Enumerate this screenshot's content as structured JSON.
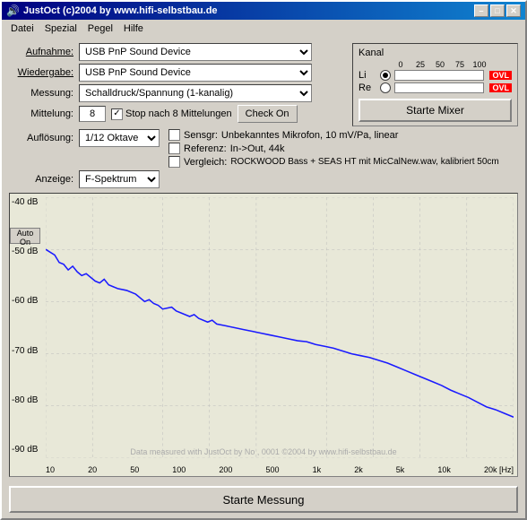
{
  "window": {
    "title": "JustOct (c)2004 by www.hifi-selbstbau.de",
    "min_btn": "–",
    "max_btn": "□",
    "close_btn": "✕"
  },
  "menu": {
    "items": [
      "Datei",
      "Spezial",
      "Pegel",
      "Hilfe"
    ]
  },
  "form": {
    "aufnahme_label": "Aufnahme:",
    "aufnahme_value": "USB PnP Sound Device",
    "wiedergabe_label": "Wiedergabe:",
    "wiedergabe_value": "USB PnP Sound Device",
    "messung_label": "Messung:",
    "messung_value": "Schalldruck/Spannung (1-kanalig)",
    "mittelung_label": "Mittelung:",
    "mittelung_input": "8",
    "mittelung_stop": "Stop nach 8 Mittelungen",
    "mittelung_check": "Check On",
    "aufloesung_label": "Auflösung:",
    "aufloesung_value": "1/12 Oktave",
    "sensor_label": "Sensgr:",
    "sensor_value": "Unbekanntes Mikrofon, 10 mV/Pa, linear",
    "referenz_label": "Referenz:",
    "referenz_value": "In->Out, 44k",
    "vergleich_label": "Vergleich:",
    "vergleich_value": "ROCKWOOD Bass + SEAS HT mit MicCalNew.wav, kalibriert 50cm",
    "anzeige_label": "Anzeige:",
    "anzeige_value": "F-Spektrum"
  },
  "kanal": {
    "title": "Kanal",
    "li_label": "Li",
    "re_label": "Re",
    "ovl_label": "OVL",
    "scale": [
      "0",
      "25",
      "50",
      "75",
      "100"
    ],
    "starte_mixer": "Starte Mixer"
  },
  "chart": {
    "y_labels": [
      "-40 dB",
      "-50 dB",
      "-60 dB",
      "-70 dB",
      "-80 dB",
      "-90 dB"
    ],
    "x_labels": [
      "10",
      "20",
      "50",
      "100",
      "200",
      "500",
      "1k",
      "2k",
      "5k",
      "10k",
      "20k [Hz]"
    ],
    "watermark": "Data measured with JustOct by No , 0001 ©2004 by www.hifi-selbstbau.de"
  },
  "bottom": {
    "starte_messung": "Starte Messung"
  }
}
